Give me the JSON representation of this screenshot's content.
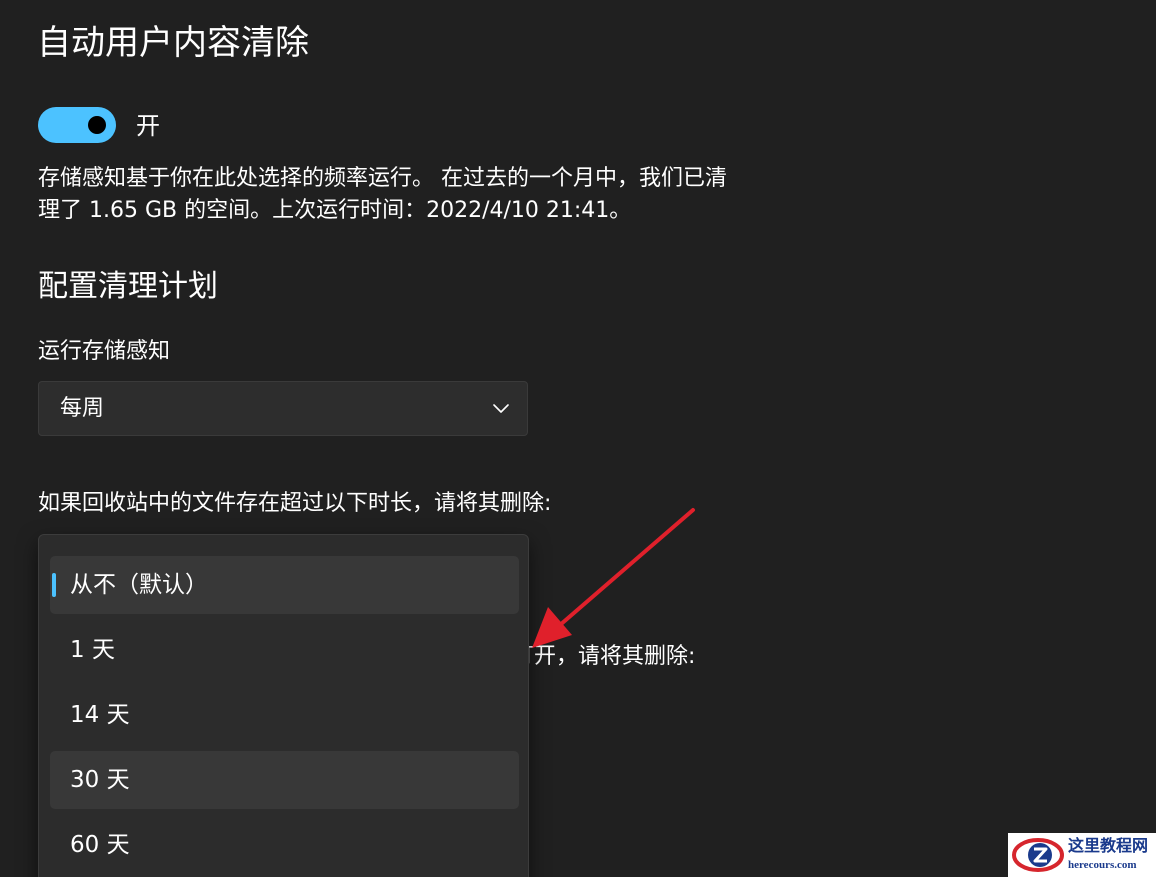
{
  "header": {
    "title": "自动用户内容清除"
  },
  "toggle": {
    "state_label": "开",
    "on": true
  },
  "description": {
    "line1": "存储感知基于你在此处选择的频率运行。 在过去的一个月中，我们已清",
    "line2": "理了 1.65 GB 的空间。上次运行时间：2022/4/10 21:41。"
  },
  "schedule": {
    "section_title": "配置清理计划",
    "run_label": "运行存储感知",
    "run_value": "每周",
    "recycle_label": "如果回收站中的文件存在超过以下时长，请将其删除:",
    "downloads_label_partial": "打开，请将其删除:"
  },
  "recycle_flyout": {
    "options": [
      {
        "label": "从不（默认）",
        "selected": true
      },
      {
        "label": "1 天"
      },
      {
        "label": "14 天"
      },
      {
        "label": "30 天",
        "hovered": true
      },
      {
        "label": "60 天"
      }
    ]
  },
  "watermark": {
    "name_cn": "这里教程网",
    "domain": "herecours.com"
  },
  "colors": {
    "background": "#202020",
    "accent": "#4cc2ff",
    "annotation_arrow": "#e0202b",
    "flyout": "#2c2c2c"
  },
  "icons": {
    "dropdown": "chevron-down-icon",
    "annotation": "red-arrow-annotation"
  }
}
